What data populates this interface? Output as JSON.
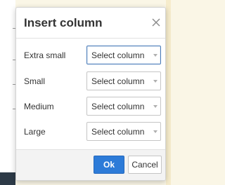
{
  "dialog": {
    "title": "Insert column",
    "close_icon": "close-icon",
    "rows": [
      {
        "label": "Extra small",
        "value": "Select column"
      },
      {
        "label": "Small",
        "value": "Select column"
      },
      {
        "label": "Medium",
        "value": "Select column"
      },
      {
        "label": "Large",
        "value": "Select column"
      }
    ],
    "ok_label": "Ok",
    "cancel_label": "Cancel"
  },
  "colors": {
    "primary": "#2d7bd8",
    "focus_border": "#4a7cb9",
    "background": "#faf6e6"
  }
}
